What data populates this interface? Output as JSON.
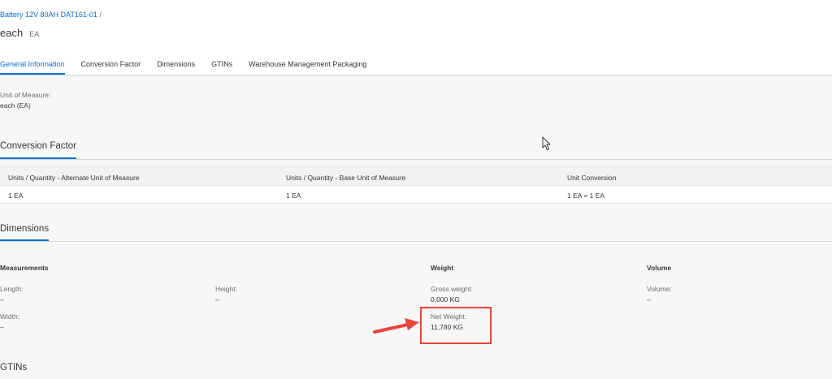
{
  "header": {
    "breadcrumb": "Battery 12V 80AH DAT161-01",
    "breadcrumb_sep": "/",
    "title": "each",
    "subtitle": "EA"
  },
  "tabs": [
    {
      "label": "General Information",
      "active": true
    },
    {
      "label": "Conversion Factor",
      "active": false
    },
    {
      "label": "Dimensions",
      "active": false
    },
    {
      "label": "GTINs",
      "active": false
    },
    {
      "label": "Warehouse Management Packaging",
      "active": false
    }
  ],
  "general": {
    "uom_label": "Unit of Measure:",
    "uom_value": "each (EA)"
  },
  "conversion": {
    "title": "Conversion Factor",
    "columns": [
      "Units / Quantity - Alternate Unit of Measure",
      "Units / Quantity - Base Unit of Measure",
      "Unit Conversion"
    ],
    "rows": [
      [
        "1 EA",
        "1 EA",
        "1 EA = 1 EA"
      ]
    ]
  },
  "dimensions": {
    "title": "Dimensions",
    "measurements": {
      "title": "Measurements",
      "length_label": "Length:",
      "length_value": "–",
      "height_label": "Height:",
      "height_value": "–",
      "width_label": "Width:",
      "width_value": "–"
    },
    "weight": {
      "title": "Weight",
      "gross_label": "Gross weight:",
      "gross_value": "0,000 KG",
      "net_label": "Net Weight:",
      "net_value": "11,780 KG"
    },
    "volume": {
      "title": "Volume",
      "volume_label": "Volume:",
      "volume_value": "–"
    }
  },
  "gtins": {
    "title": "GTINs"
  },
  "colors": {
    "accent": "#0a6ed1",
    "annotation": "#e8453c"
  }
}
